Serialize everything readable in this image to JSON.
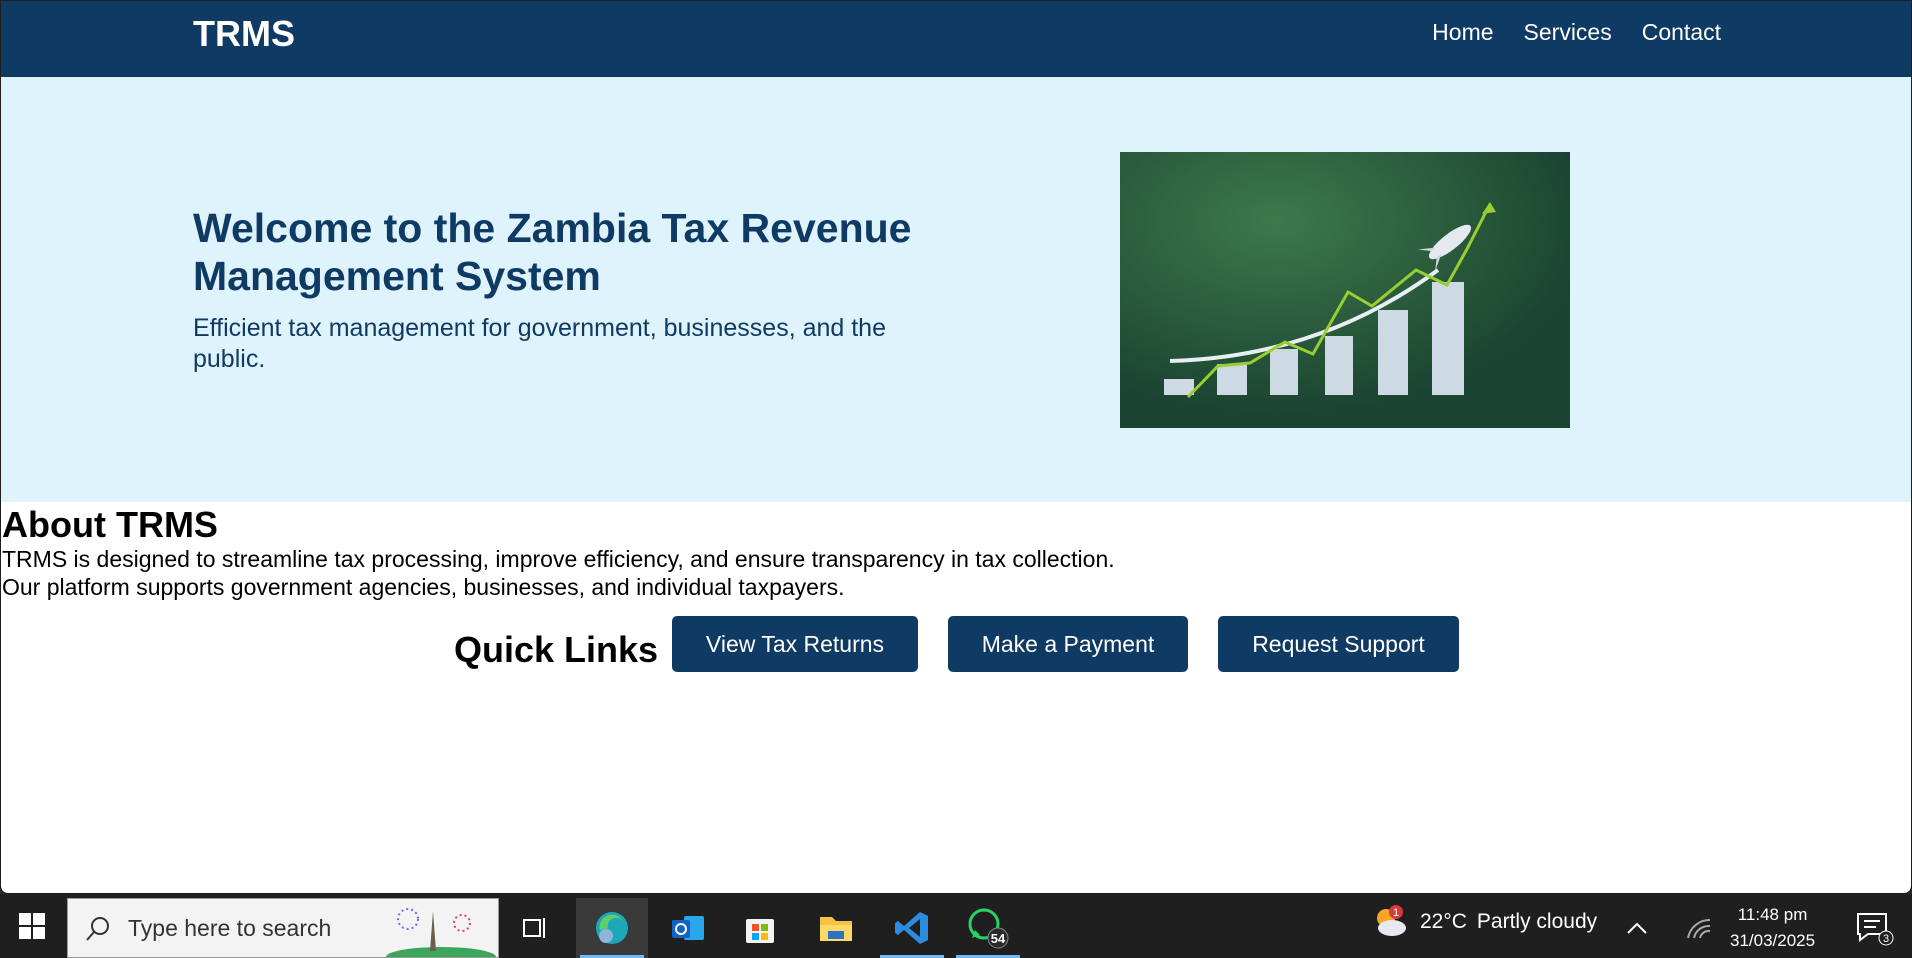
{
  "nav": {
    "brand": "TRMS",
    "links": [
      "Home",
      "Services",
      "Contact"
    ]
  },
  "hero": {
    "title": "Welcome to the Zambia Tax Revenue Management System",
    "subtitle": "Efficient tax management for government, businesses, and the public."
  },
  "about": {
    "title": "About TRMS",
    "line1": "TRMS is designed to streamline tax processing, improve efficiency, and ensure transparency in tax collection.",
    "line2": "Our platform supports government agencies, businesses, and individual taxpayers."
  },
  "quick_links": {
    "title": "Quick Links",
    "buttons": [
      "View Tax Returns",
      "Make a Payment",
      "Request Support"
    ]
  },
  "taskbar": {
    "search_placeholder": "Type here to search",
    "weather_temp": "22°C",
    "weather_desc": "Partly cloudy",
    "weather_badge": "1",
    "time": "11:48 pm",
    "date": "31/03/2025",
    "whatsapp_badge": "54",
    "notifications_badge": "3"
  },
  "colors": {
    "navy": "#0f3a63",
    "hero_bg": "#dff3fd",
    "chart_bg": "#1d4a35",
    "accent_green": "#9acd32"
  }
}
